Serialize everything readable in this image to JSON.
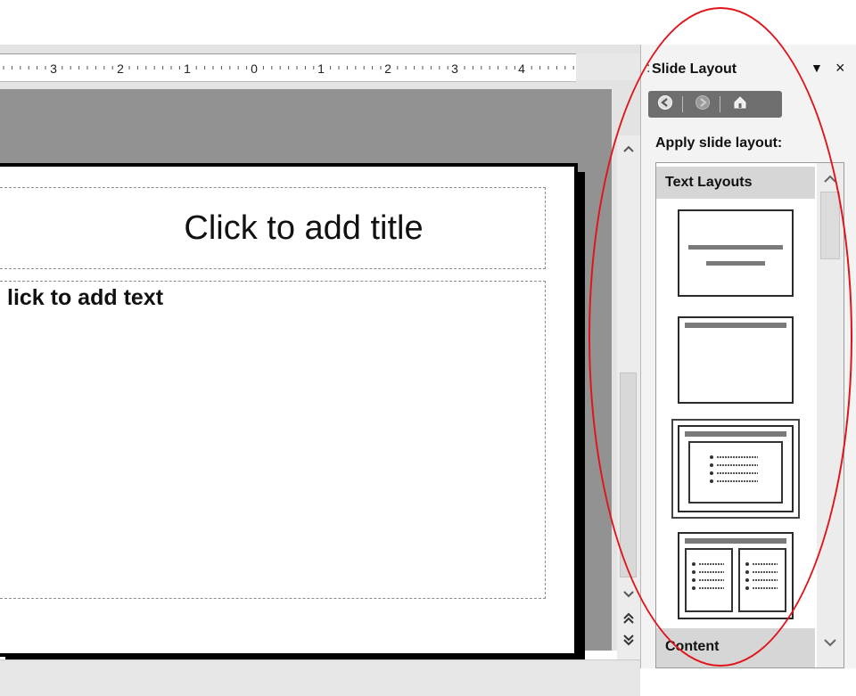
{
  "ruler": {
    "labels": [
      "3",
      "2",
      "1",
      "0",
      "1",
      "2",
      "3",
      "4"
    ]
  },
  "slide": {
    "title_placeholder": "Click to add title",
    "body_placeholder": "lick to add text"
  },
  "task_pane": {
    "title": "Slide Layout",
    "grip_glyph": ":",
    "dropdown_glyph": "▼",
    "close_glyph": "×",
    "nav": {
      "back_icon": "back-icon",
      "forward_icon": "forward-icon",
      "home_icon": "home-icon"
    },
    "apply_label": "Apply slide layout:",
    "sections": [
      "Text Layouts",
      "Content"
    ],
    "layouts": [
      {
        "name": "title-slide"
      },
      {
        "name": "title-only"
      },
      {
        "name": "title-and-text",
        "selected": true
      },
      {
        "name": "title-and-2-column-text"
      }
    ]
  },
  "colors": {
    "highlight": "#e0141b",
    "work_area": "#929292",
    "nav_bar": "#6e6e6e"
  }
}
